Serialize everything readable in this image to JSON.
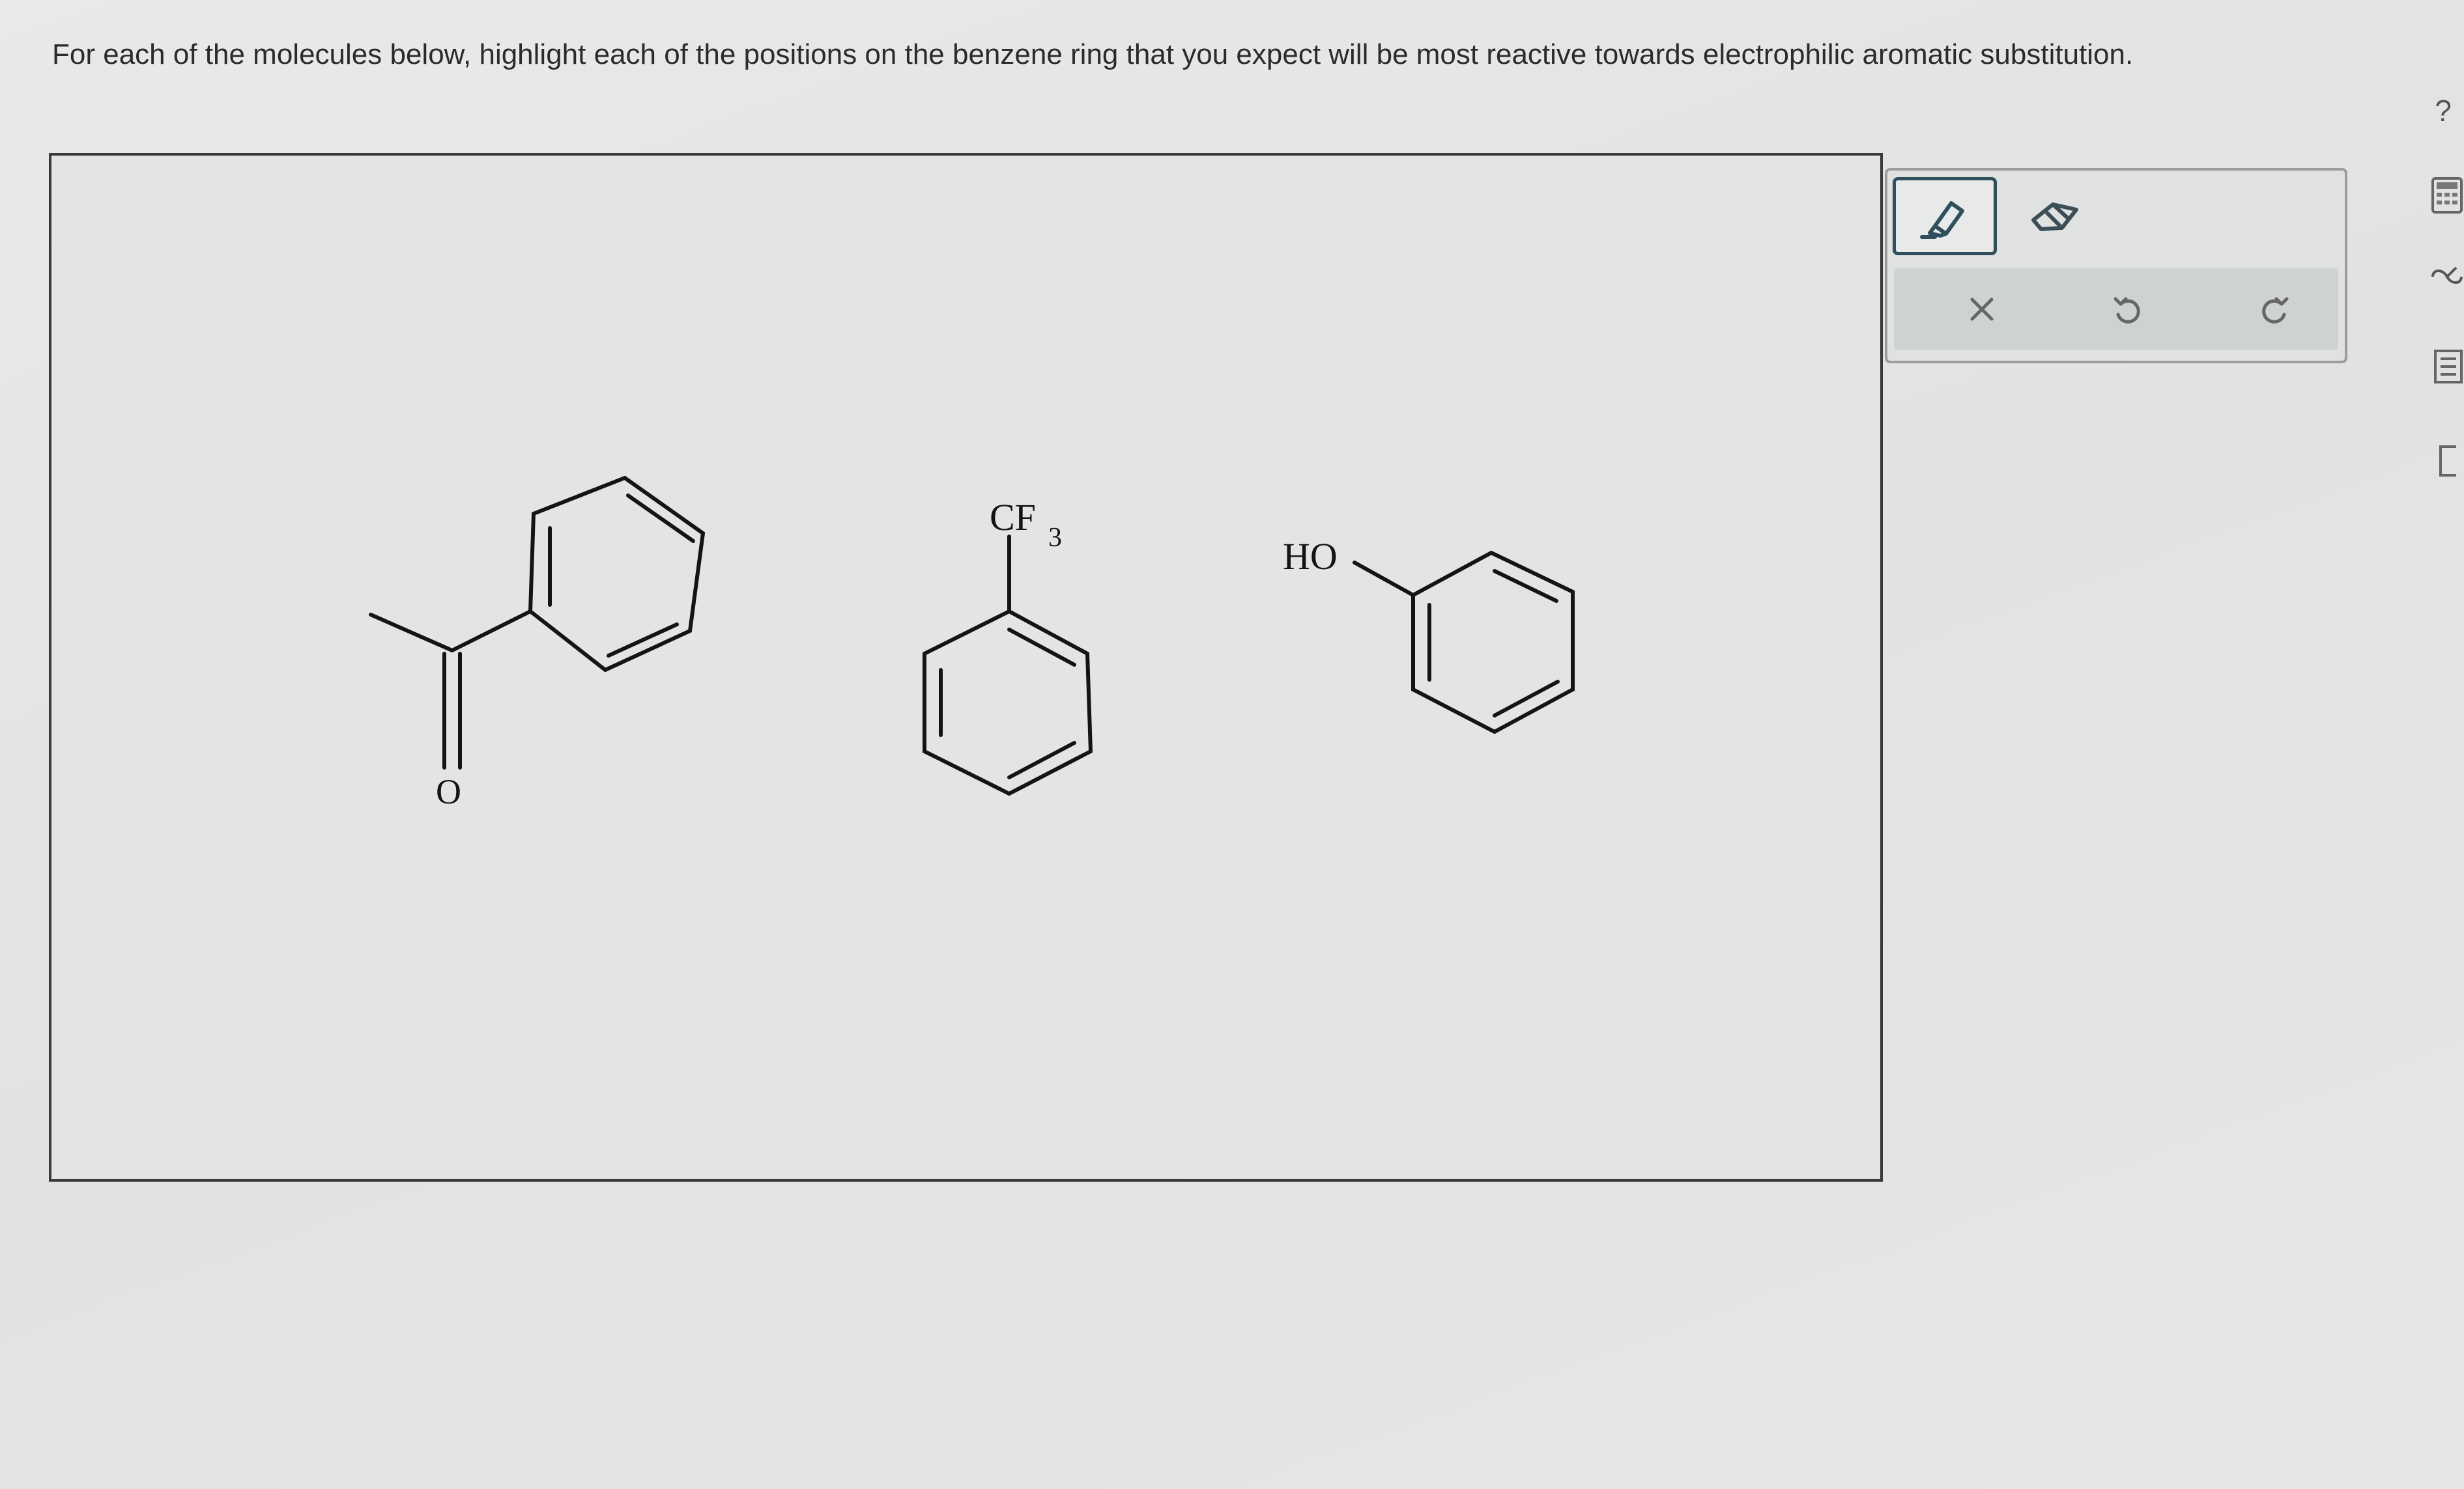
{
  "question": {
    "text": "For each of the molecules below, highlight each of the positions on the benzene ring that you expect will be most reactive towards electrophilic aromatic substitution."
  },
  "molecules": [
    {
      "id": "acetophenone",
      "labels": {
        "oxygen": "O"
      }
    },
    {
      "id": "trifluoromethylbenzene",
      "labels": {
        "substituent": "CF",
        "subscript": "3"
      }
    },
    {
      "id": "benzyl-alcohol",
      "labels": {
        "hydroxyl": "HO"
      }
    }
  ],
  "toolbar": {
    "tools": [
      {
        "id": "highlighter",
        "icon": "highlighter-icon",
        "selected": true
      },
      {
        "id": "eraser",
        "icon": "eraser-icon",
        "selected": false
      }
    ],
    "actions": [
      {
        "id": "clear",
        "icon": "close-icon"
      },
      {
        "id": "undo",
        "icon": "undo-icon"
      },
      {
        "id": "redo",
        "icon": "redo-icon"
      }
    ]
  },
  "right_rail": {
    "help_label": "?",
    "icons": [
      "calculator-icon",
      "periodic-table-icon",
      "reference-icon",
      "document-icon"
    ]
  },
  "colors": {
    "selected_tool_border": "#2f4f5c",
    "action_bar": "#cfd2d3",
    "bond": "#141414"
  }
}
